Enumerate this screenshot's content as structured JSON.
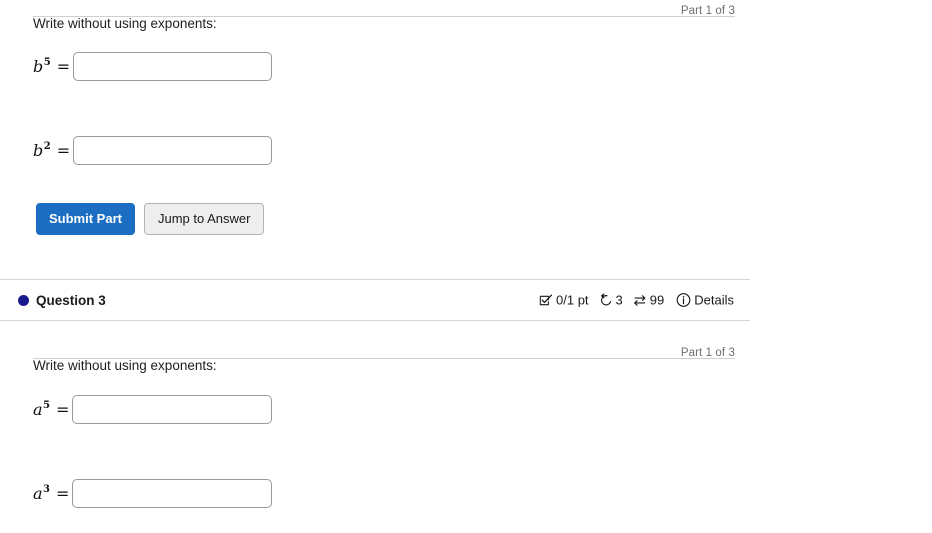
{
  "questions": [
    {
      "part_label": "Part 1 of 3",
      "prompt": "Write without using exponents:",
      "rows": [
        {
          "base": "b",
          "exponent": "5",
          "equals": "=",
          "value": "",
          "placeholder": ""
        },
        {
          "base": "b",
          "exponent": "2",
          "equals": "=",
          "value": "",
          "placeholder": ""
        }
      ],
      "buttons": {
        "submit_label": "Submit Part",
        "jump_label": "Jump to Answer"
      }
    },
    {
      "header": {
        "title": "Question 3",
        "bullet_color": "#1a1a8c",
        "stats": {
          "score_icon": "checkbox-check-icon",
          "score": "0/1 pt",
          "attempts_icon": "undo-arrow-icon",
          "attempts": "3",
          "reattempts_icon": "swap-arrows-icon",
          "reattempts": "99",
          "details_icon": "info-circle-icon",
          "details_label": "Details"
        }
      },
      "part_label": "Part 1 of 3",
      "prompt": "Write without using exponents:",
      "rows": [
        {
          "base": "a",
          "exponent": "5",
          "equals": "=",
          "value": "",
          "placeholder": ""
        },
        {
          "base": "a",
          "exponent": "3",
          "equals": "=",
          "value": "",
          "placeholder": ""
        }
      ]
    }
  ],
  "theme": {
    "primary_button_color": "#1b6ec2",
    "secondary_button_color": "#eeeeee",
    "divider_color": "#d6d6d6",
    "muted_text_color": "#6e6e6e"
  }
}
